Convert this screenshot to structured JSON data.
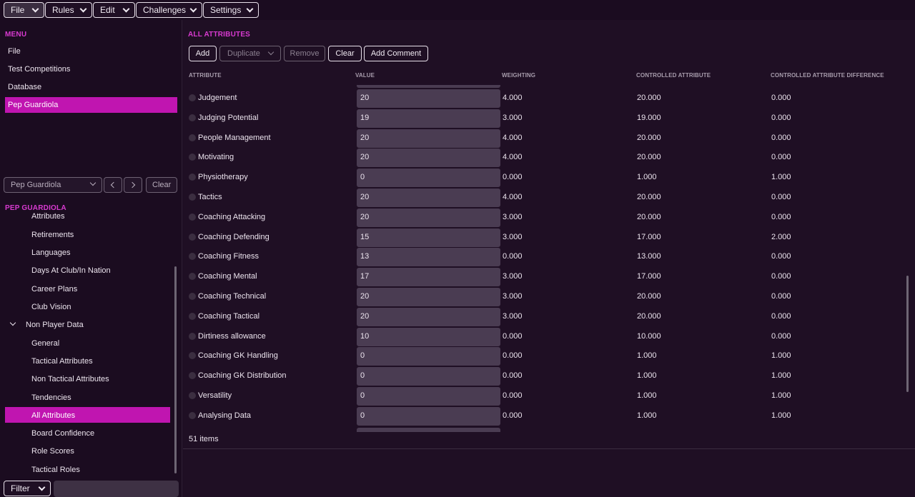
{
  "menubar": {
    "items": [
      {
        "label": "File"
      },
      {
        "label": "Rules"
      },
      {
        "label": "Edit"
      },
      {
        "label": "Challenges"
      },
      {
        "label": "Settings"
      }
    ]
  },
  "left": {
    "menu_title": "MENU",
    "menu_items": [
      "File",
      "Test Competitions",
      "Database",
      "Pep Guardiola"
    ],
    "person_select": "Pep Guardiola",
    "clear_label": "Clear",
    "section_title": "PEP GUARDIOLA",
    "tree_partial": "Attributes",
    "tree_items": [
      "Retirements",
      "Languages",
      "Days At Club/In Nation",
      "Career Plans",
      "Club Vision"
    ],
    "tree_group": "Non Player Data",
    "tree_subitems": [
      "General",
      "Tactical Attributes",
      "Non Tactical Attributes",
      "Tendencies",
      "All Attributes",
      "Board Confidence",
      "Role Scores",
      "Tactical Roles"
    ],
    "filter_label": "Filter"
  },
  "main": {
    "title": "ALL ATTRIBUTES",
    "toolbar": {
      "add": "Add",
      "duplicate": "Duplicate",
      "remove": "Remove",
      "clear": "Clear",
      "add_comment": "Add Comment"
    },
    "columns": {
      "attribute": "ATTRIBUTE",
      "value": "VALUE",
      "weighting": "WEIGHTING",
      "controlled": "CONTROLLED ATTRIBUTE",
      "difference": "CONTROLLED ATTRIBUTE DIFFERENCE"
    },
    "rows": [
      {
        "name": "Judgement",
        "value": "20",
        "weighting": "4.000",
        "controlled": "20.000",
        "difference": "0.000"
      },
      {
        "name": "Judging Potential",
        "value": "19",
        "weighting": "3.000",
        "controlled": "19.000",
        "difference": "0.000"
      },
      {
        "name": "People Management",
        "value": "20",
        "weighting": "4.000",
        "controlled": "20.000",
        "difference": "0.000"
      },
      {
        "name": "Motivating",
        "value": "20",
        "weighting": "4.000",
        "controlled": "20.000",
        "difference": "0.000"
      },
      {
        "name": "Physiotherapy",
        "value": "0",
        "weighting": "0.000",
        "controlled": "1.000",
        "difference": "1.000"
      },
      {
        "name": "Tactics",
        "value": "20",
        "weighting": "4.000",
        "controlled": "20.000",
        "difference": "0.000"
      },
      {
        "name": "Coaching Attacking",
        "value": "20",
        "weighting": "3.000",
        "controlled": "20.000",
        "difference": "0.000"
      },
      {
        "name": "Coaching Defending",
        "value": "15",
        "weighting": "3.000",
        "controlled": "17.000",
        "difference": "2.000"
      },
      {
        "name": "Coaching Fitness",
        "value": "13",
        "weighting": "0.000",
        "controlled": "13.000",
        "difference": "0.000"
      },
      {
        "name": "Coaching Mental",
        "value": "17",
        "weighting": "3.000",
        "controlled": "17.000",
        "difference": "0.000"
      },
      {
        "name": "Coaching Technical",
        "value": "20",
        "weighting": "3.000",
        "controlled": "20.000",
        "difference": "0.000"
      },
      {
        "name": "Coaching Tactical",
        "value": "20",
        "weighting": "3.000",
        "controlled": "20.000",
        "difference": "0.000"
      },
      {
        "name": "Dirtiness allowance",
        "value": "10",
        "weighting": "0.000",
        "controlled": "10.000",
        "difference": "0.000"
      },
      {
        "name": "Coaching GK Handling",
        "value": "0",
        "weighting": "0.000",
        "controlled": "1.000",
        "difference": "1.000"
      },
      {
        "name": "Coaching GK Distribution",
        "value": "0",
        "weighting": "0.000",
        "controlled": "1.000",
        "difference": "1.000"
      },
      {
        "name": "Versatility",
        "value": "0",
        "weighting": "0.000",
        "controlled": "1.000",
        "difference": "1.000"
      },
      {
        "name": "Analysing Data",
        "value": "0",
        "weighting": "0.000",
        "controlled": "1.000",
        "difference": "1.000"
      }
    ],
    "count": "51 items"
  }
}
